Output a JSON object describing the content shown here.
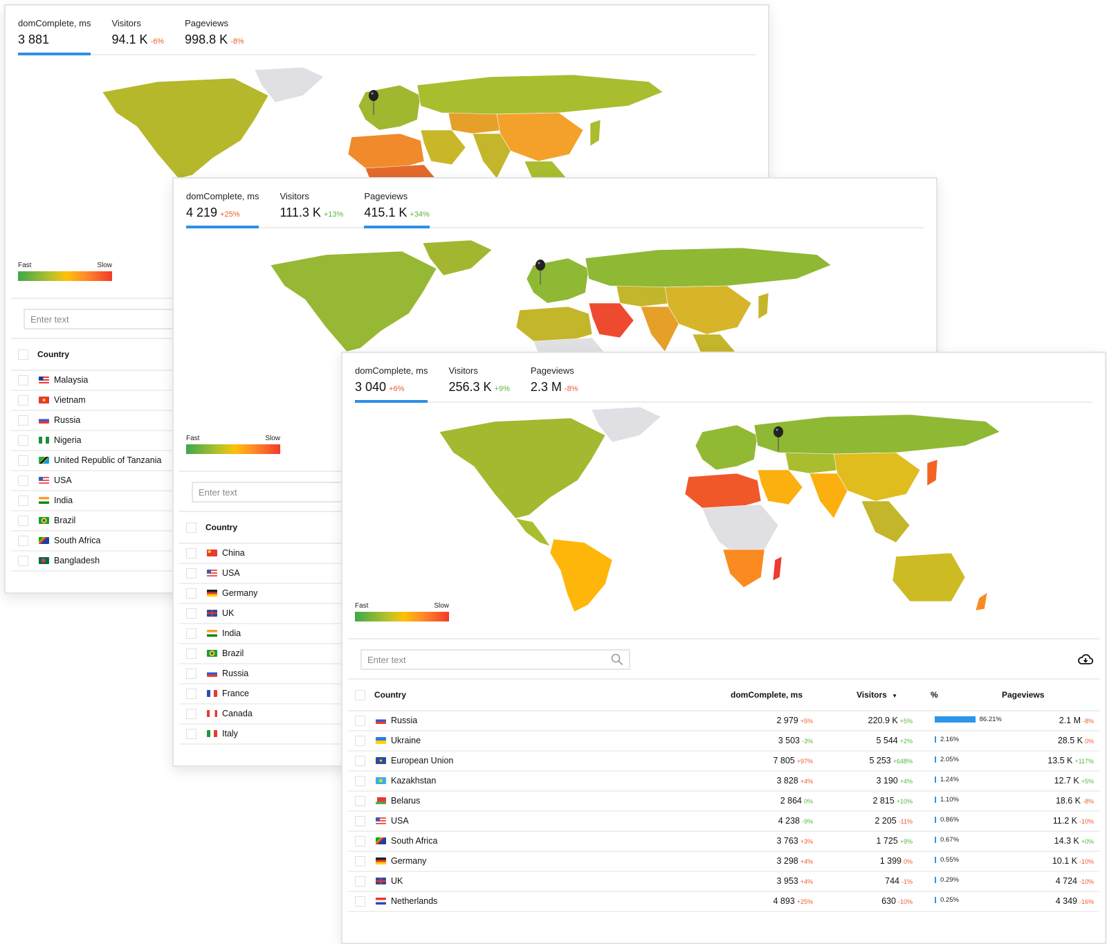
{
  "colors": {
    "accent": "#2d8fe6",
    "increase_bad": "#f05a2a",
    "decrease_good": "#58b53a",
    "legend_fast": "#3fa84a",
    "legend_mid": "#ffc107",
    "legend_slow": "#f33a2a",
    "no_data": "#e0e0e4"
  },
  "panels": [
    {
      "metrics": [
        {
          "label": "domComplete, ms",
          "value": "3 881",
          "delta": "",
          "active": true
        },
        {
          "label": "Visitors",
          "value": "94.1 K",
          "delta": "-6%",
          "delta_color": "bad"
        },
        {
          "label": "Pageviews",
          "value": "998.8 K",
          "delta": "-8%",
          "delta_color": "bad"
        }
      ],
      "legend": {
        "fast": "Fast",
        "slow": "Slow"
      },
      "search": {
        "placeholder": "Enter text"
      },
      "table": {
        "columns": [
          "Country"
        ],
        "rows": [
          {
            "country": "Malaysia",
            "flag": "malaysia-flag"
          },
          {
            "country": "Vietnam",
            "flag": "vietnam-flag"
          },
          {
            "country": "Russia",
            "flag": "russia-flag"
          },
          {
            "country": "Nigeria",
            "flag": "nigeria-flag"
          },
          {
            "country": "United Republic of Tanzania",
            "flag": "tanzania-flag"
          },
          {
            "country": "USA",
            "flag": "usa-flag"
          },
          {
            "country": "India",
            "flag": "india-flag"
          },
          {
            "country": "Brazil",
            "flag": "brazil-flag"
          },
          {
            "country": "South Africa",
            "flag": "south-africa-flag"
          },
          {
            "country": "Bangladesh",
            "flag": "bangladesh-flag"
          }
        ]
      }
    },
    {
      "metrics": [
        {
          "label": "domComplete, ms",
          "value": "4 219",
          "delta": "+25%",
          "delta_color": "bad",
          "active": true
        },
        {
          "label": "Visitors",
          "value": "111.3 K",
          "delta": "+13%",
          "delta_color": "good"
        },
        {
          "label": "Pageviews",
          "value": "415.1 K",
          "delta": "+34%",
          "delta_color": "good",
          "active": true
        }
      ],
      "legend": {
        "fast": "Fast",
        "slow": "Slow"
      },
      "search": {
        "placeholder": "Enter text"
      },
      "table": {
        "columns": [
          "Country"
        ],
        "rows": [
          {
            "country": "China",
            "flag": "china-flag"
          },
          {
            "country": "USA",
            "flag": "usa-flag"
          },
          {
            "country": "Germany",
            "flag": "germany-flag"
          },
          {
            "country": "UK",
            "flag": "uk-flag"
          },
          {
            "country": "India",
            "flag": "india-flag"
          },
          {
            "country": "Brazil",
            "flag": "brazil-flag"
          },
          {
            "country": "Russia",
            "flag": "russia-flag"
          },
          {
            "country": "France",
            "flag": "france-flag"
          },
          {
            "country": "Canada",
            "flag": "canada-flag"
          },
          {
            "country": "Italy",
            "flag": "italy-flag"
          }
        ]
      }
    },
    {
      "metrics": [
        {
          "label": "domComplete, ms",
          "value": "3 040",
          "delta": "+6%",
          "delta_color": "bad",
          "active": true
        },
        {
          "label": "Visitors",
          "value": "256.3 K",
          "delta": "+9%",
          "delta_color": "good"
        },
        {
          "label": "Pageviews",
          "value": "2.3 M",
          "delta": "-8%",
          "delta_color": "bad"
        }
      ],
      "legend": {
        "fast": "Fast",
        "slow": "Slow"
      },
      "search": {
        "placeholder": "Enter text"
      },
      "download_icon": "cloud-download-icon",
      "table": {
        "columns": [
          "Country",
          "domComplete, ms",
          "Visitors",
          "%",
          "Pageviews"
        ],
        "sort_column": "Visitors",
        "sort_direction": "desc",
        "rows": [
          {
            "country": "Russia",
            "flag": "russia-flag",
            "dom": "2 979",
            "dom_delta": "+5%",
            "dom_dc": "bad",
            "visitors": "220.9 K",
            "vis_delta": "+5%",
            "vis_dc": "good",
            "pct": "86.21%",
            "pct_value": 86.21,
            "pageviews": "2.1 M",
            "pv_delta": "-8%",
            "pv_dc": "bad"
          },
          {
            "country": "Ukraine",
            "flag": "ukraine-flag",
            "dom": "3 503",
            "dom_delta": "-3%",
            "dom_dc": "good",
            "visitors": "5 544",
            "vis_delta": "+2%",
            "vis_dc": "good",
            "pct": "2.16%",
            "pct_value": 2.16,
            "pageviews": "28.5 K",
            "pv_delta": "0%",
            "pv_dc": "bad"
          },
          {
            "country": "European Union",
            "flag": "eu-flag",
            "dom": "7 805",
            "dom_delta": "+97%",
            "dom_dc": "bad",
            "visitors": "5 253",
            "vis_delta": "+648%",
            "vis_dc": "good",
            "pct": "2.05%",
            "pct_value": 2.05,
            "pageviews": "13.5 K",
            "pv_delta": "+117%",
            "pv_dc": "good"
          },
          {
            "country": "Kazakhstan",
            "flag": "kazakhstan-flag",
            "dom": "3 828",
            "dom_delta": "+4%",
            "dom_dc": "bad",
            "visitors": "3 190",
            "vis_delta": "+4%",
            "vis_dc": "good",
            "pct": "1.24%",
            "pct_value": 1.24,
            "pageviews": "12.7 K",
            "pv_delta": "+5%",
            "pv_dc": "good"
          },
          {
            "country": "Belarus",
            "flag": "belarus-flag",
            "dom": "2 864",
            "dom_delta": "0%",
            "dom_dc": "good",
            "visitors": "2 815",
            "vis_delta": "+10%",
            "vis_dc": "good",
            "pct": "1.10%",
            "pct_value": 1.1,
            "pageviews": "18.6 K",
            "pv_delta": "-8%",
            "pv_dc": "bad"
          },
          {
            "country": "USA",
            "flag": "usa-flag",
            "dom": "4 238",
            "dom_delta": "-9%",
            "dom_dc": "good",
            "visitors": "2 205",
            "vis_delta": "-11%",
            "vis_dc": "bad",
            "pct": "0.86%",
            "pct_value": 0.86,
            "pageviews": "11.2 K",
            "pv_delta": "-10%",
            "pv_dc": "bad"
          },
          {
            "country": "South Africa",
            "flag": "south-africa-flag",
            "dom": "3 763",
            "dom_delta": "+3%",
            "dom_dc": "bad",
            "visitors": "1 725",
            "vis_delta": "+9%",
            "vis_dc": "good",
            "pct": "0.67%",
            "pct_value": 0.67,
            "pageviews": "14.3 K",
            "pv_delta": "+0%",
            "pv_dc": "good"
          },
          {
            "country": "Germany",
            "flag": "germany-flag",
            "dom": "3 298",
            "dom_delta": "+4%",
            "dom_dc": "bad",
            "visitors": "1 399",
            "vis_delta": "0%",
            "vis_dc": "bad",
            "pct": "0.55%",
            "pct_value": 0.55,
            "pageviews": "10.1 K",
            "pv_delta": "-10%",
            "pv_dc": "bad"
          },
          {
            "country": "UK",
            "flag": "uk-flag",
            "dom": "3 953",
            "dom_delta": "+4%",
            "dom_dc": "bad",
            "visitors": "744",
            "vis_delta": "-1%",
            "vis_dc": "bad",
            "pct": "0.29%",
            "pct_value": 0.29,
            "pageviews": "4 724",
            "pv_delta": "-10%",
            "pv_dc": "bad"
          },
          {
            "country": "Netherlands",
            "flag": "netherlands-flag",
            "dom": "4 893",
            "dom_delta": "+25%",
            "dom_dc": "bad",
            "visitors": "630",
            "vis_delta": "-10%",
            "vis_dc": "bad",
            "pct": "0.25%",
            "pct_value": 0.25,
            "pageviews": "4 349",
            "pv_delta": "-16%",
            "pv_dc": "bad"
          }
        ]
      }
    }
  ]
}
